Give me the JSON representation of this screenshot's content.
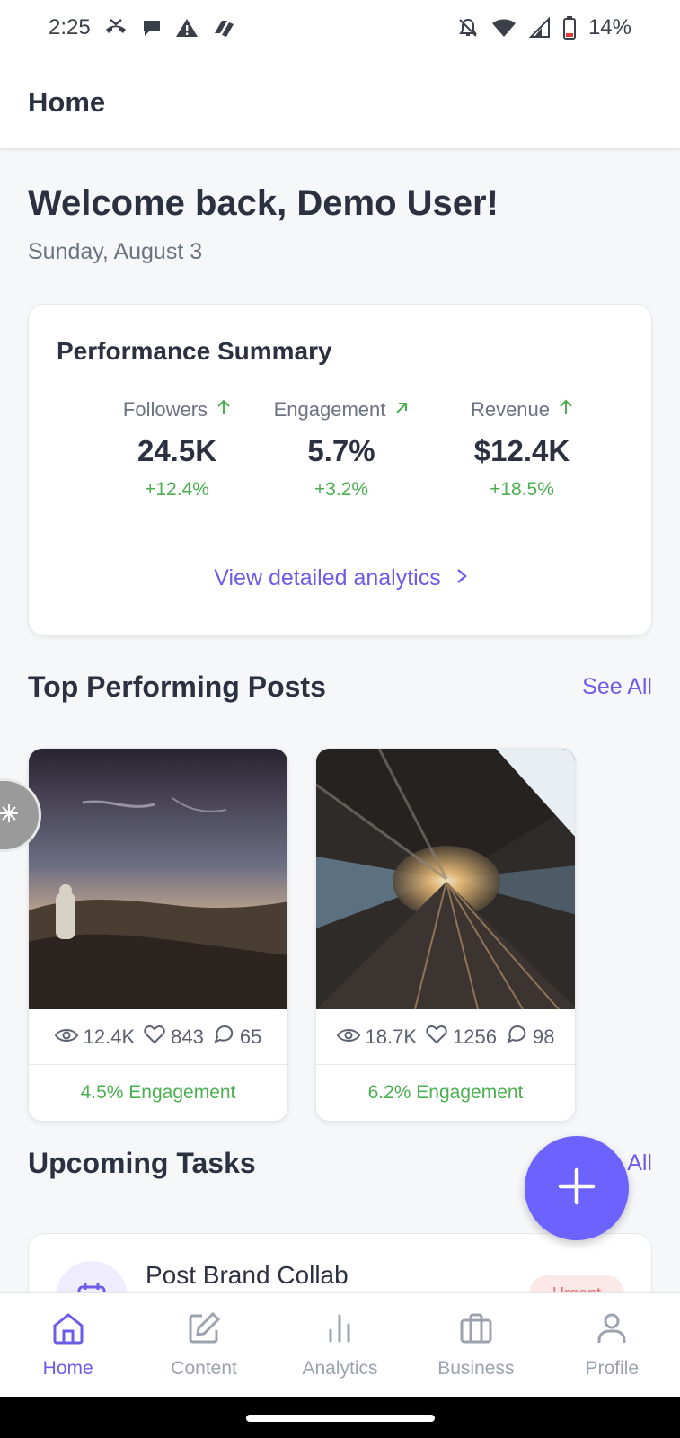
{
  "status_bar": {
    "time": "2:25",
    "battery": "14%",
    "icons": [
      "missed-call-icon",
      "chat-bubble-icon",
      "warning-icon",
      "app-logo-icon",
      "bell-off-icon",
      "wifi-icon",
      "signal-icon",
      "battery-icon"
    ]
  },
  "app_bar": {
    "title": "Home"
  },
  "welcome": {
    "heading": "Welcome back, Demo User!",
    "date": "Sunday, August 3"
  },
  "performance": {
    "title": "Performance Summary",
    "metrics": [
      {
        "label": "Followers",
        "value": "24.5K",
        "change": "+12.4%",
        "trend_icon": "arrow-up-icon"
      },
      {
        "label": "Engagement",
        "value": "5.7%",
        "change": "+3.2%",
        "trend_icon": "arrow-up-right-icon"
      },
      {
        "label": "Revenue",
        "value": "$12.4K",
        "change": "+18.5%",
        "trend_icon": "arrow-up-icon"
      }
    ],
    "link": "View detailed analytics"
  },
  "top_posts": {
    "title": "Top Performing Posts",
    "see_all": "See All",
    "posts": [
      {
        "views": "12.4K",
        "likes": "843",
        "comments": "65",
        "engagement": "4.5% Engagement"
      },
      {
        "views": "18.7K",
        "likes": "1256",
        "comments": "98",
        "engagement": "6.2% Engagement"
      }
    ]
  },
  "tasks": {
    "title": "Upcoming Tasks",
    "see_all": "All",
    "items": [
      {
        "title": "Post Brand Collab",
        "badge": "Urgent"
      }
    ]
  },
  "bottom_nav": {
    "items": [
      {
        "label": "Home",
        "icon": "home-icon",
        "active": true
      },
      {
        "label": "Content",
        "icon": "edit-icon",
        "active": false
      },
      {
        "label": "Analytics",
        "icon": "bar-chart-icon",
        "active": false
      },
      {
        "label": "Business",
        "icon": "briefcase-icon",
        "active": false
      },
      {
        "label": "Profile",
        "icon": "user-icon",
        "active": false
      }
    ]
  },
  "colors": {
    "accent": "#6c5ce7",
    "fab": "#6c63ff",
    "positive": "#4caf50",
    "background": "#f6f7f9"
  }
}
